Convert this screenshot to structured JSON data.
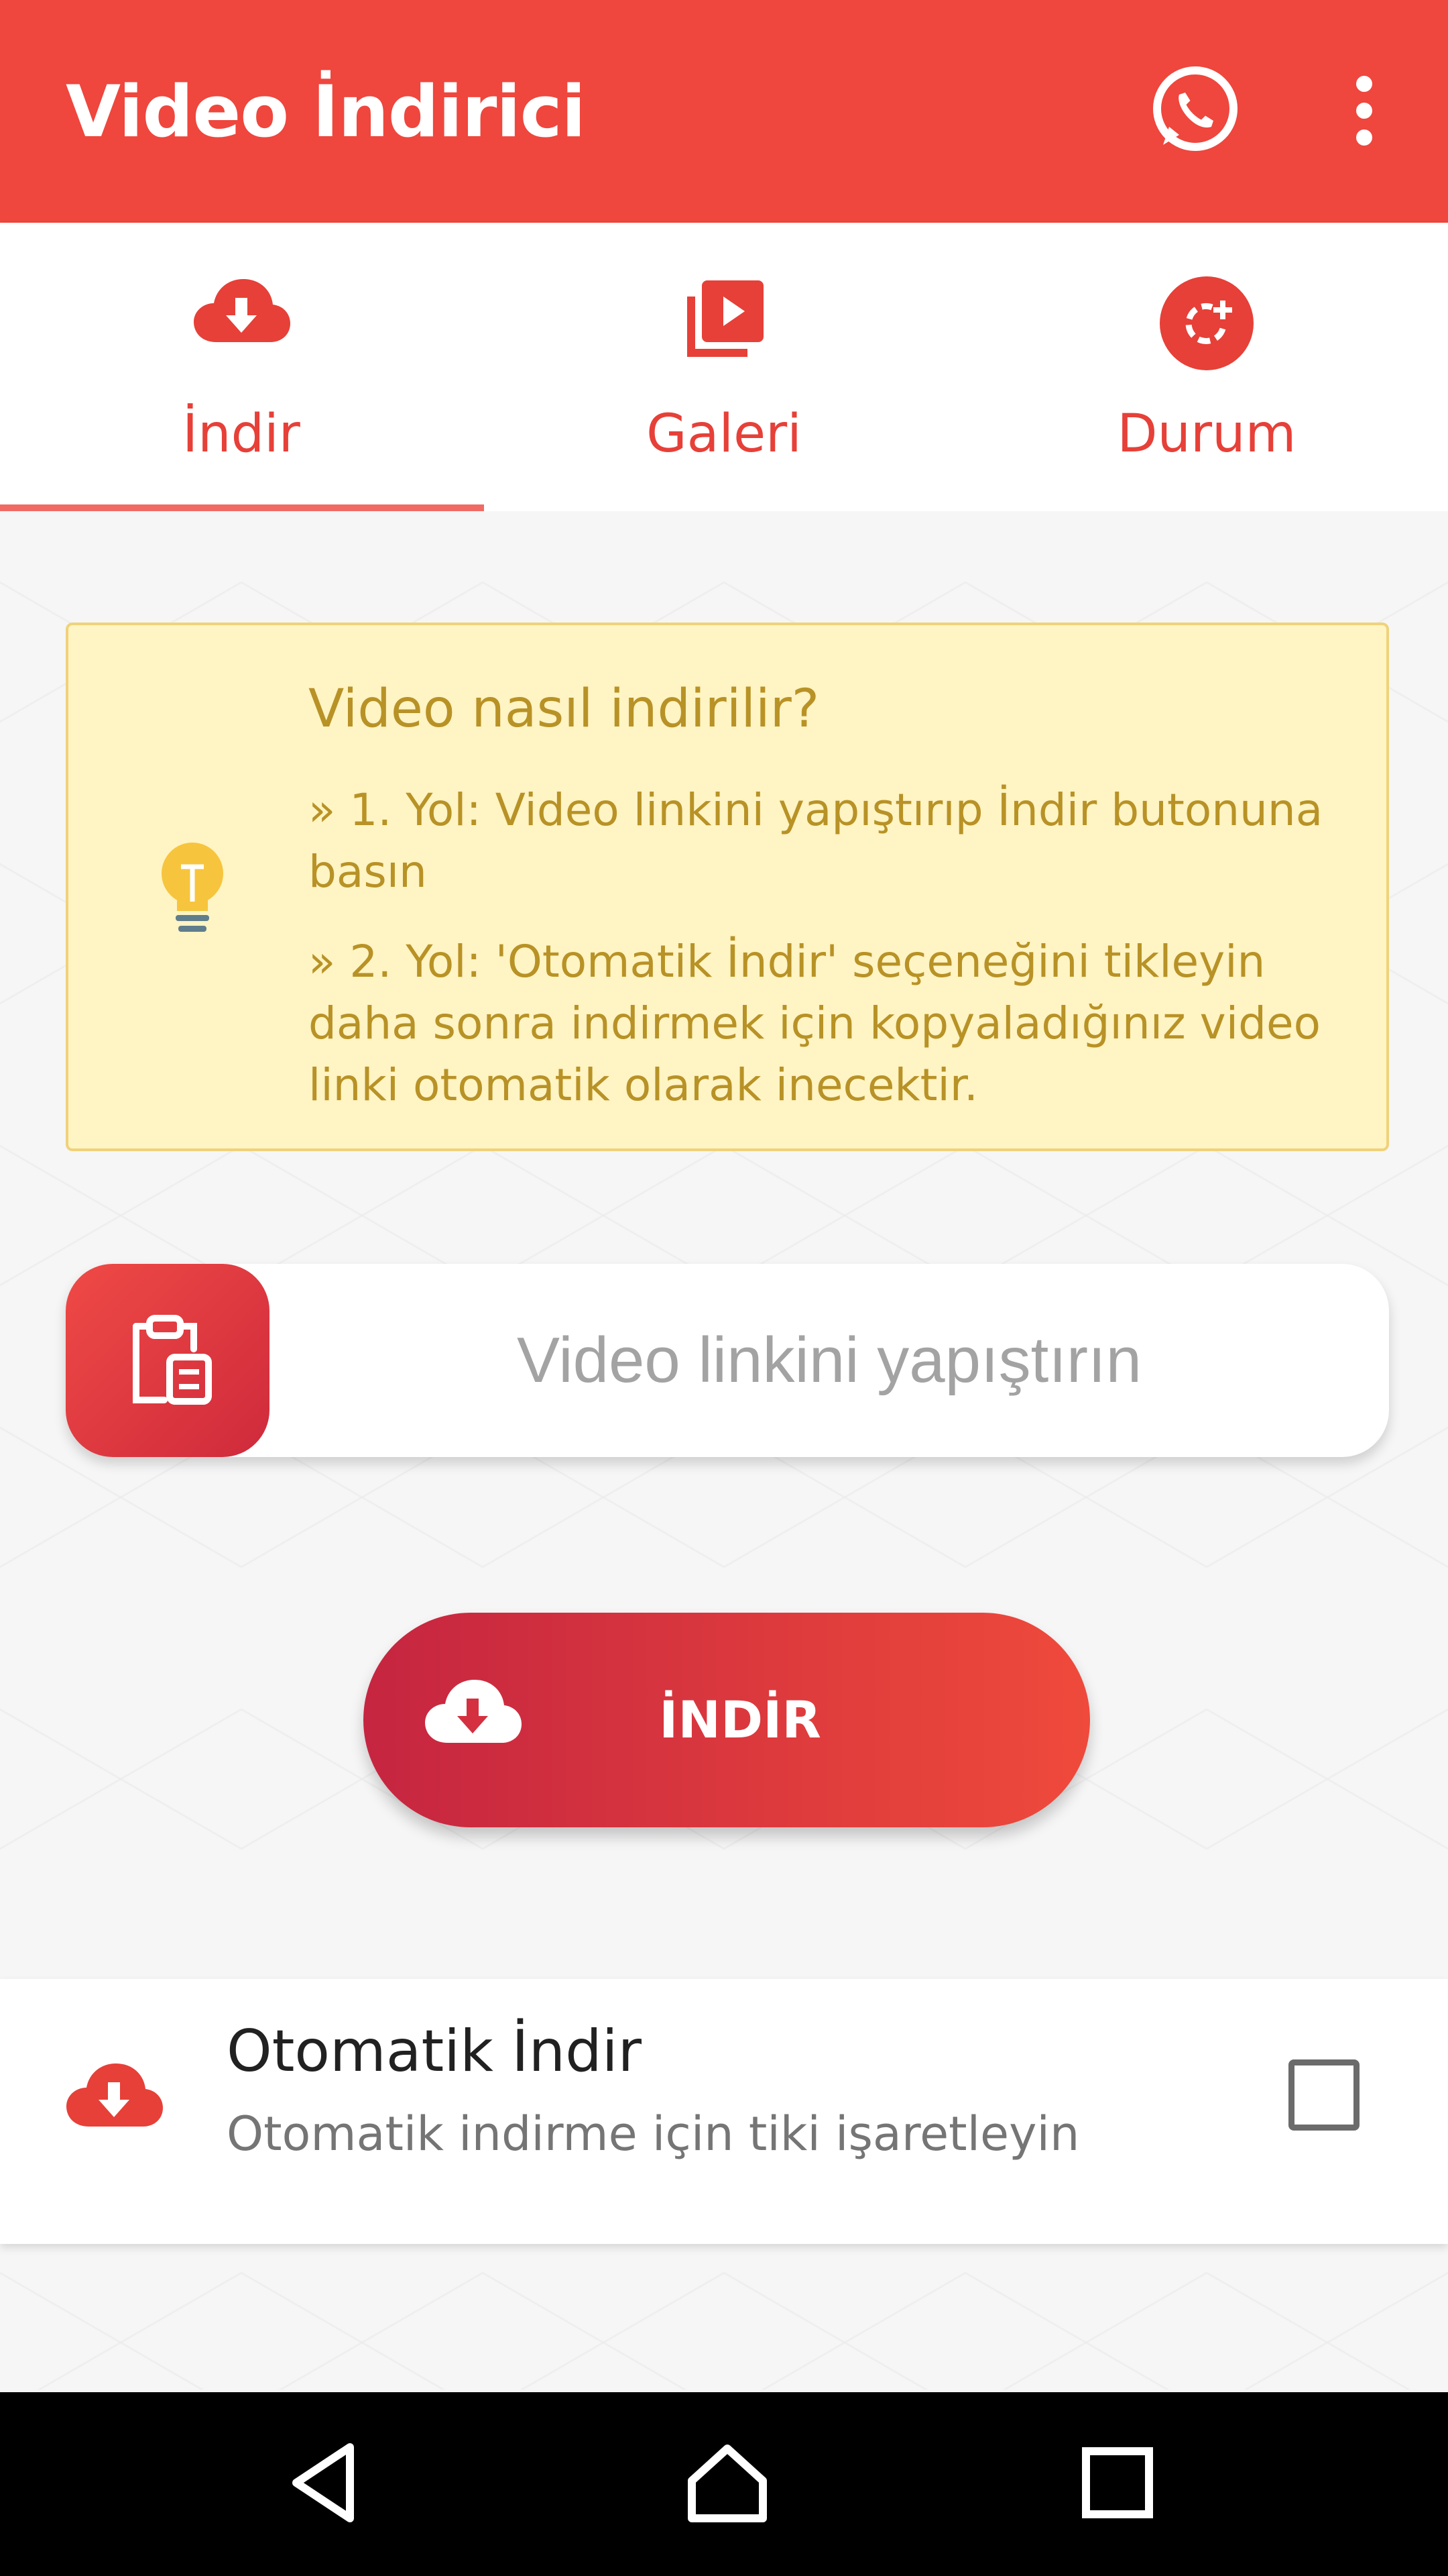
{
  "appbar": {
    "title": "Video İndirici",
    "icons": [
      "whatsapp-icon",
      "more-vertical-icon"
    ]
  },
  "tabs": [
    {
      "label": "İndir",
      "icon": "cloud-download-icon",
      "selected": true
    },
    {
      "label": "Galeri",
      "icon": "video-library-icon",
      "selected": false
    },
    {
      "label": "Durum",
      "icon": "status-refresh-icon",
      "selected": false
    }
  ],
  "info": {
    "title": "Video nasıl indirilir?",
    "lines": [
      "» 1. Yol: Video linkini yapıştırıp İndir butonuna basın",
      "» 2. Yol: 'Otomatik İndir' seçeneğini tikleyin daha sonra indirmek için kopyaladığınız video linki otomatik olarak inecektir."
    ],
    "icon": "lightbulb-icon"
  },
  "link_input": {
    "placeholder": "Video linkini yapıştırın",
    "value": "",
    "paste_icon": "clipboard-icon"
  },
  "download_button": {
    "label": "İNDİR",
    "icon": "cloud-download-icon"
  },
  "auto_download": {
    "title": "Otomatik İndir",
    "subtitle": "Otomatik indirme için tiki işaretleyin",
    "checked": false,
    "icon": "cloud-download-icon"
  },
  "navbar": {
    "buttons": [
      "back-icon",
      "home-icon",
      "recents-icon"
    ]
  },
  "colors": {
    "primary": "#ef463d",
    "tab_text": "#e64038",
    "info_bg": "#fff4c3",
    "info_text": "#b89226"
  }
}
